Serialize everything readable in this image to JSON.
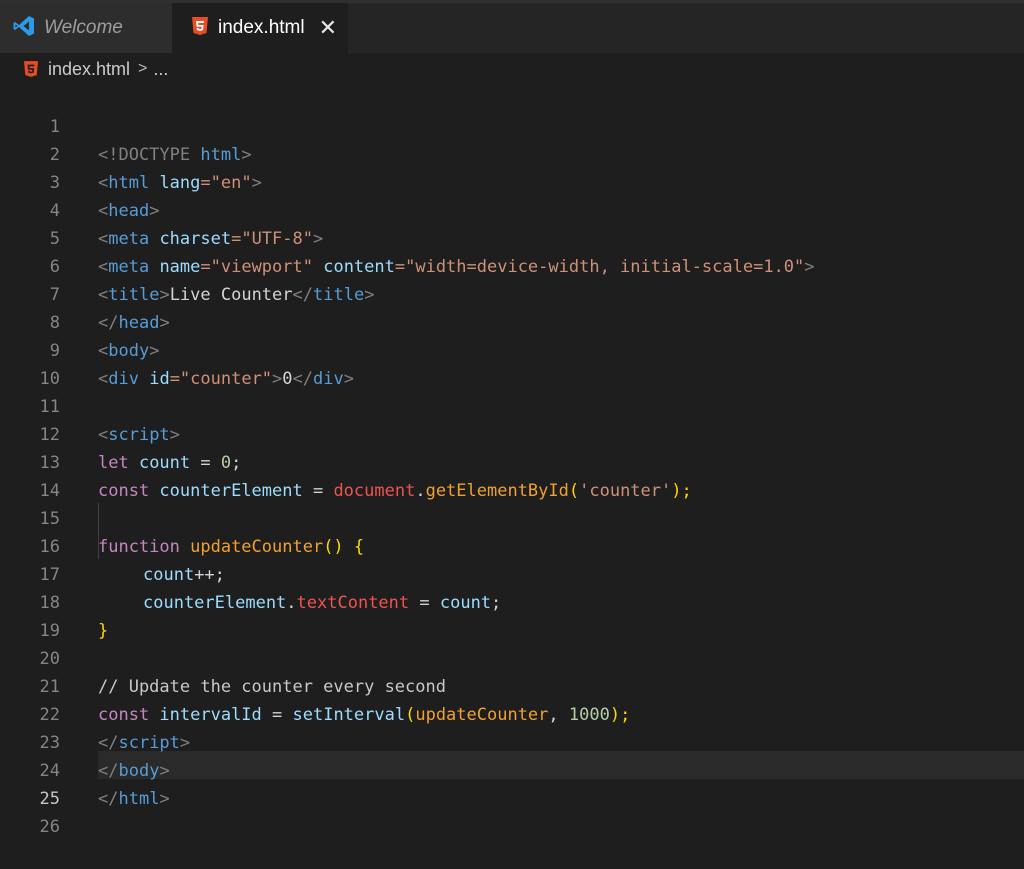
{
  "tabs": [
    {
      "label": "Welcome",
      "icon": "vscode-icon"
    },
    {
      "label": "index.html",
      "icon": "html5-icon",
      "close": "✕"
    }
  ],
  "breadcrumb": {
    "file": "index.html",
    "sep": ">",
    "rest": "..."
  },
  "line_numbers": [
    "1",
    "2",
    "3",
    "4",
    "5",
    "6",
    "7",
    "8",
    "9",
    "10",
    "11",
    "12",
    "13",
    "14",
    "15",
    "16",
    "17",
    "18",
    "19",
    "20",
    "21",
    "22",
    "23",
    "24",
    "25",
    "26"
  ],
  "code": {
    "l1": {
      "a": "<!DOCTYPE ",
      "b": "html",
      "c": ">"
    },
    "l2": {
      "a": "<",
      "b": "html",
      "c": " lang",
      "d": "=\"en\"",
      "e": ">"
    },
    "l3": {
      "a": "<",
      "b": "head",
      "c": ">"
    },
    "l4": {
      "a": "<",
      "b": "meta",
      "c": " charset",
      "d": "=\"UTF-8\"",
      "e": ">"
    },
    "l5": {
      "a": "<",
      "b": "meta",
      "c": " name",
      "d": "=\"viewport\"",
      "e": " content",
      "f": "=\"width=device-width, initial-scale=1.0\"",
      "g": ">"
    },
    "l6": {
      "a": "<",
      "b": "title",
      "c": ">",
      "d": "Live Counter",
      "e": "</",
      "f": "title",
      "g": ">"
    },
    "l7": {
      "a": "</",
      "b": "head",
      "c": ">"
    },
    "l8": {
      "a": "<",
      "b": "body",
      "c": ">"
    },
    "l9": {
      "a": "<",
      "b": "div",
      "c": " id",
      "d": "=\"counter\"",
      "e": ">",
      "f": "0",
      "g": "</",
      "h": "div",
      "i": ">"
    },
    "l11": {
      "a": "<",
      "b": "script",
      "c": ">"
    },
    "l12": {
      "a": "let",
      "b": " count",
      "c": " = ",
      "d": "0",
      "e": ";"
    },
    "l13": {
      "a": "const",
      "b": " counterElement",
      "c": " = ",
      "d": "document",
      "e": ".",
      "f": "getElementById",
      "g": "(",
      "h": "'counter'",
      "i": ");"
    },
    "l15": {
      "a": "function",
      "b": " updateCounter",
      "c": "()",
      "d": " {"
    },
    "l16": {
      "a": "count",
      "b": "++;"
    },
    "l17": {
      "a": "counterElement",
      "b": ".",
      "c": "textContent",
      "d": " = ",
      "e": "count",
      "f": ";"
    },
    "l18": {
      "a": "}"
    },
    "l20": {
      "a": "// Update the counter every second"
    },
    "l21": {
      "a": "const",
      "b": " intervalId",
      "c": " = ",
      "d": "setInterval",
      "e": "(",
      "f": "updateCounter",
      "g": ", ",
      "h": "1000",
      "i": ");"
    },
    "l22": {
      "a": "</",
      "b": "script",
      "c": ">"
    },
    "l23": {
      "a": "</",
      "b": "body",
      "c": ">"
    },
    "l24": {
      "a": "</",
      "b": "html",
      "c": ">"
    }
  }
}
